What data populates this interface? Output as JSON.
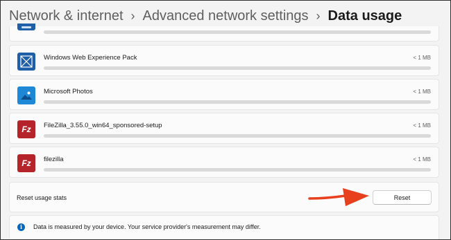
{
  "breadcrumb": {
    "items": [
      "Network & internet",
      "Advanced network settings",
      "Data usage"
    ],
    "separator": "›"
  },
  "apps": [
    {
      "name": "",
      "size": "",
      "icon": "generic-app-icon"
    },
    {
      "name": "Windows Web Experience Pack",
      "size": "< 1 MB",
      "icon": "web-experience-pack-icon"
    },
    {
      "name": "Microsoft Photos",
      "size": "< 1 MB",
      "icon": "photos-icon"
    },
    {
      "name": "FileZilla_3.55.0_win64_sponsored-setup",
      "size": "< 1 MB",
      "icon": "filezilla-icon"
    },
    {
      "name": "filezilla",
      "size": "< 1 MB",
      "icon": "filezilla-icon"
    }
  ],
  "filezilla_glyph": "Fz",
  "reset": {
    "label": "Reset usage stats",
    "button_label": "Reset"
  },
  "info": {
    "icon_glyph": "i",
    "text": "Data is measured by your device. Your service provider's measurement may differ."
  },
  "colors": {
    "accent": "#0067c0",
    "filezilla_red": "#b5242b",
    "arrow": "#e8401c"
  }
}
